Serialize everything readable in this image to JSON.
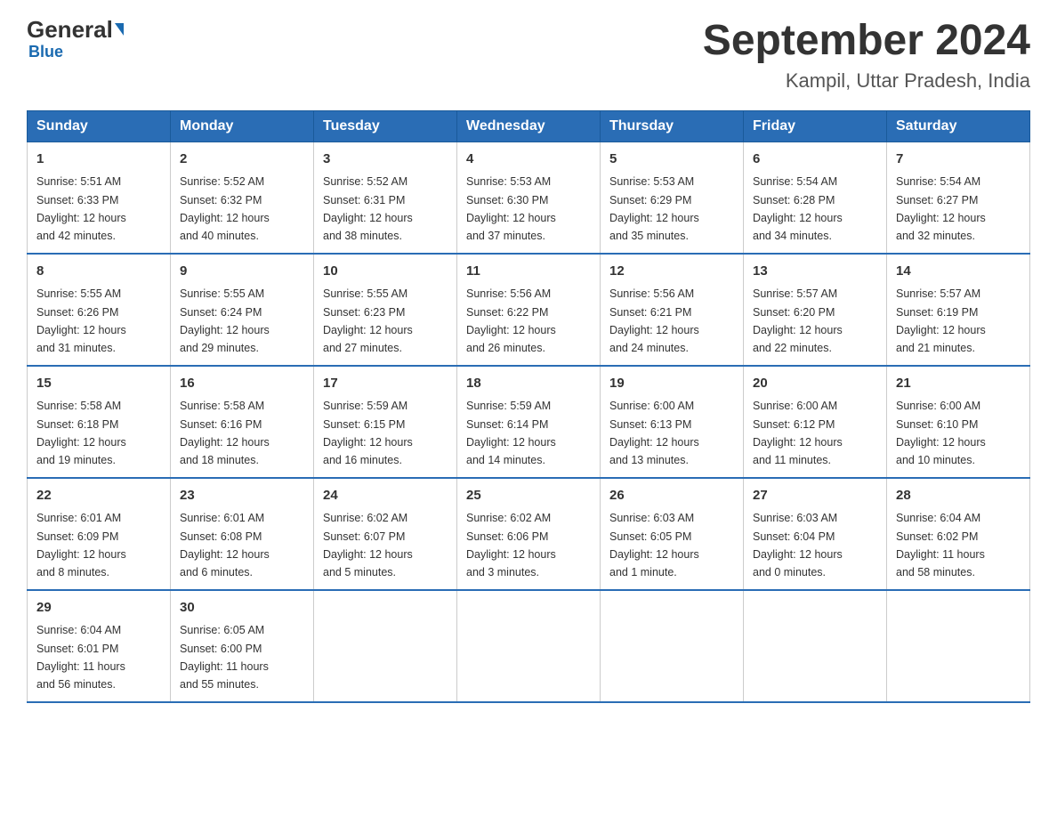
{
  "logo": {
    "text_general": "General",
    "text_blue": "Blue",
    "subtitle": "Blue"
  },
  "header": {
    "main_title": "September 2024",
    "subtitle": "Kampil, Uttar Pradesh, India"
  },
  "days_of_week": [
    "Sunday",
    "Monday",
    "Tuesday",
    "Wednesday",
    "Thursday",
    "Friday",
    "Saturday"
  ],
  "weeks": [
    [
      {
        "day": "1",
        "sunrise": "5:51 AM",
        "sunset": "6:33 PM",
        "daylight": "12 hours and 42 minutes."
      },
      {
        "day": "2",
        "sunrise": "5:52 AM",
        "sunset": "6:32 PM",
        "daylight": "12 hours and 40 minutes."
      },
      {
        "day": "3",
        "sunrise": "5:52 AM",
        "sunset": "6:31 PM",
        "daylight": "12 hours and 38 minutes."
      },
      {
        "day": "4",
        "sunrise": "5:53 AM",
        "sunset": "6:30 PM",
        "daylight": "12 hours and 37 minutes."
      },
      {
        "day": "5",
        "sunrise": "5:53 AM",
        "sunset": "6:29 PM",
        "daylight": "12 hours and 35 minutes."
      },
      {
        "day": "6",
        "sunrise": "5:54 AM",
        "sunset": "6:28 PM",
        "daylight": "12 hours and 34 minutes."
      },
      {
        "day": "7",
        "sunrise": "5:54 AM",
        "sunset": "6:27 PM",
        "daylight": "12 hours and 32 minutes."
      }
    ],
    [
      {
        "day": "8",
        "sunrise": "5:55 AM",
        "sunset": "6:26 PM",
        "daylight": "12 hours and 31 minutes."
      },
      {
        "day": "9",
        "sunrise": "5:55 AM",
        "sunset": "6:24 PM",
        "daylight": "12 hours and 29 minutes."
      },
      {
        "day": "10",
        "sunrise": "5:55 AM",
        "sunset": "6:23 PM",
        "daylight": "12 hours and 27 minutes."
      },
      {
        "day": "11",
        "sunrise": "5:56 AM",
        "sunset": "6:22 PM",
        "daylight": "12 hours and 26 minutes."
      },
      {
        "day": "12",
        "sunrise": "5:56 AM",
        "sunset": "6:21 PM",
        "daylight": "12 hours and 24 minutes."
      },
      {
        "day": "13",
        "sunrise": "5:57 AM",
        "sunset": "6:20 PM",
        "daylight": "12 hours and 22 minutes."
      },
      {
        "day": "14",
        "sunrise": "5:57 AM",
        "sunset": "6:19 PM",
        "daylight": "12 hours and 21 minutes."
      }
    ],
    [
      {
        "day": "15",
        "sunrise": "5:58 AM",
        "sunset": "6:18 PM",
        "daylight": "12 hours and 19 minutes."
      },
      {
        "day": "16",
        "sunrise": "5:58 AM",
        "sunset": "6:16 PM",
        "daylight": "12 hours and 18 minutes."
      },
      {
        "day": "17",
        "sunrise": "5:59 AM",
        "sunset": "6:15 PM",
        "daylight": "12 hours and 16 minutes."
      },
      {
        "day": "18",
        "sunrise": "5:59 AM",
        "sunset": "6:14 PM",
        "daylight": "12 hours and 14 minutes."
      },
      {
        "day": "19",
        "sunrise": "6:00 AM",
        "sunset": "6:13 PM",
        "daylight": "12 hours and 13 minutes."
      },
      {
        "day": "20",
        "sunrise": "6:00 AM",
        "sunset": "6:12 PM",
        "daylight": "12 hours and 11 minutes."
      },
      {
        "day": "21",
        "sunrise": "6:00 AM",
        "sunset": "6:10 PM",
        "daylight": "12 hours and 10 minutes."
      }
    ],
    [
      {
        "day": "22",
        "sunrise": "6:01 AM",
        "sunset": "6:09 PM",
        "daylight": "12 hours and 8 minutes."
      },
      {
        "day": "23",
        "sunrise": "6:01 AM",
        "sunset": "6:08 PM",
        "daylight": "12 hours and 6 minutes."
      },
      {
        "day": "24",
        "sunrise": "6:02 AM",
        "sunset": "6:07 PM",
        "daylight": "12 hours and 5 minutes."
      },
      {
        "day": "25",
        "sunrise": "6:02 AM",
        "sunset": "6:06 PM",
        "daylight": "12 hours and 3 minutes."
      },
      {
        "day": "26",
        "sunrise": "6:03 AM",
        "sunset": "6:05 PM",
        "daylight": "12 hours and 1 minute."
      },
      {
        "day": "27",
        "sunrise": "6:03 AM",
        "sunset": "6:04 PM",
        "daylight": "12 hours and 0 minutes."
      },
      {
        "day": "28",
        "sunrise": "6:04 AM",
        "sunset": "6:02 PM",
        "daylight": "11 hours and 58 minutes."
      }
    ],
    [
      {
        "day": "29",
        "sunrise": "6:04 AM",
        "sunset": "6:01 PM",
        "daylight": "11 hours and 56 minutes."
      },
      {
        "day": "30",
        "sunrise": "6:05 AM",
        "sunset": "6:00 PM",
        "daylight": "11 hours and 55 minutes."
      },
      null,
      null,
      null,
      null,
      null
    ]
  ],
  "labels": {
    "sunrise": "Sunrise:",
    "sunset": "Sunset:",
    "daylight": "Daylight:"
  }
}
